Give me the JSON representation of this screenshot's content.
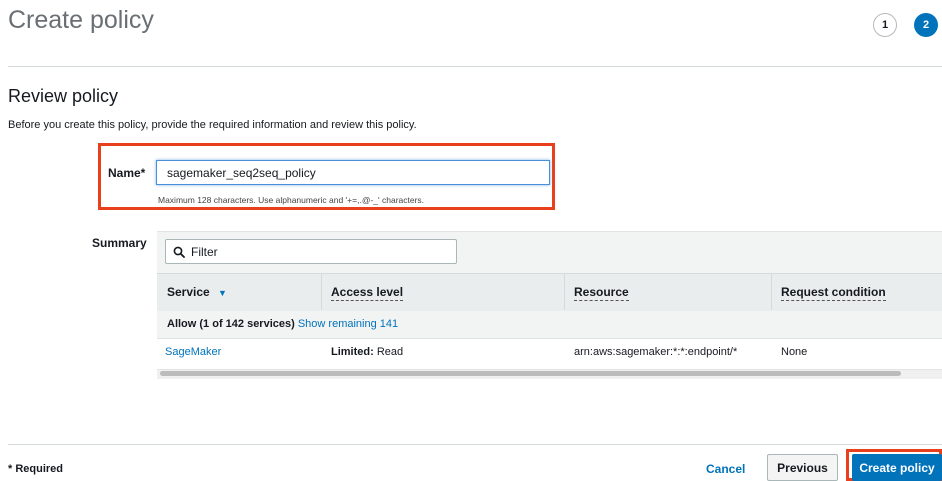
{
  "header": {
    "title": "Create policy",
    "steps": [
      "1",
      "2"
    ]
  },
  "review": {
    "title": "Review policy",
    "intro": "Before you create this policy, provide the required information and review this policy."
  },
  "name_field": {
    "label": "Name*",
    "value": "sagemaker_seq2seq_policy",
    "hint": "Maximum 128 characters. Use alphanumeric and '+=,.@-_' characters."
  },
  "summary": {
    "label": "Summary",
    "filter_placeholder": "Filter",
    "columns": [
      "Service",
      "Access level",
      "Resource",
      "Request condition"
    ],
    "group": {
      "text": "Allow (1 of 142 services)",
      "link": "Show remaining 141"
    },
    "rows": [
      {
        "service": "SageMaker",
        "access_bold": "Limited:",
        "access_rest": " Read",
        "resource": "arn:aws:sagemaker:*:*:endpoint/*",
        "condition": "None"
      }
    ]
  },
  "footer": {
    "required": "* Required",
    "cancel": "Cancel",
    "previous": "Previous",
    "create": "Create policy"
  },
  "colors": {
    "accent": "#0073bb",
    "highlight": "#e8401c"
  }
}
